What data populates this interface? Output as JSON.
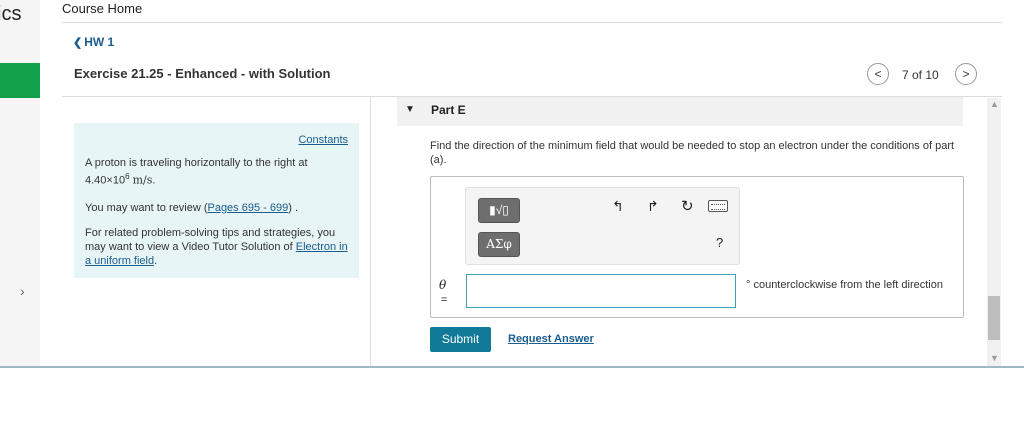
{
  "rail": {
    "brand_fragment": "ics",
    "expand_arrow": "›"
  },
  "header": {
    "course_home": "Course Home"
  },
  "assignment": {
    "back_label": "HW 1",
    "back_chevron": "❮"
  },
  "exercise": {
    "title": "Exercise 21.25 - Enhanced - with Solution"
  },
  "nav": {
    "prev_glyph": "<",
    "next_glyph": ">",
    "position": "7 of 10"
  },
  "info": {
    "constants": "Constants",
    "problem_prefix": "A proton is traveling horizontally to the right at",
    "speed_value": "4.40×10",
    "speed_exp": "6",
    "speed_unit": "m/s",
    "speed_suffix": ".",
    "review_prefix": "You may want to review (",
    "review_link": "Pages 695 - 699",
    "review_suffix": ") .",
    "tips_prefix": "For related problem-solving tips and strategies, you may want to view a Video Tutor Solution of ",
    "tips_link": "Electron in a uniform field",
    "tips_suffix": "."
  },
  "part": {
    "caret": "▼",
    "label": "Part E"
  },
  "question": {
    "text": "Find the direction of the minimum field that would be needed to stop an electron under the conditions of part (a)."
  },
  "toolbar": {
    "templates_label": "▮√▯",
    "greek_label": "ΑΣφ",
    "undo_icon": "↰",
    "redo_icon": "↱",
    "reset_icon": "↻",
    "help_label": "?"
  },
  "answer": {
    "variable": "θ",
    "equals": "=",
    "value": "",
    "unit_text": "° counterclockwise from the left direction"
  },
  "actions": {
    "submit": "Submit",
    "request_answer": "Request Answer"
  },
  "scrollbar": {
    "up": "▲",
    "down": "▼"
  }
}
